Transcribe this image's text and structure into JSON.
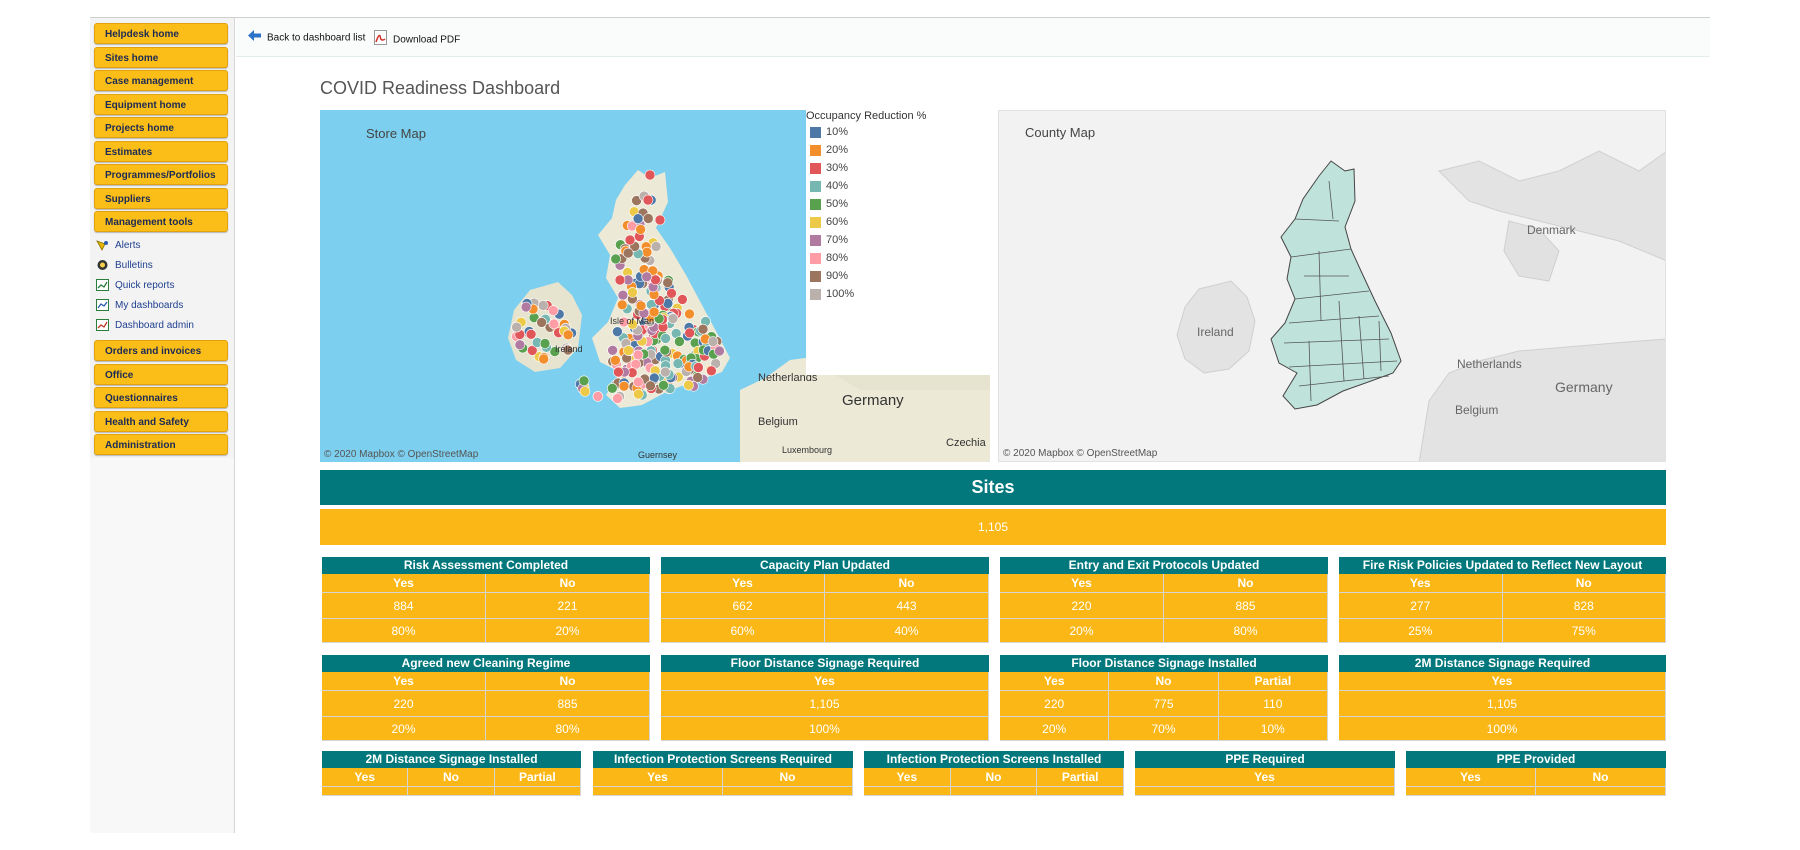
{
  "sidebar": {
    "items": [
      {
        "label": "Helpdesk home",
        "type": "button"
      },
      {
        "label": "Sites home",
        "type": "button"
      },
      {
        "label": "Case management",
        "type": "button"
      },
      {
        "label": "Equipment home",
        "type": "button"
      },
      {
        "label": "Projects home",
        "type": "button"
      },
      {
        "label": "Estimates",
        "type": "button"
      },
      {
        "label": "Programmes/Portfolios",
        "type": "button"
      },
      {
        "label": "Suppliers",
        "type": "button"
      },
      {
        "label": "Management tools",
        "type": "button"
      },
      {
        "label": "Alerts",
        "type": "link",
        "icon": "bell-icon"
      },
      {
        "label": "Bulletins",
        "type": "link",
        "icon": "bulletin-icon"
      },
      {
        "label": "Quick reports",
        "type": "link",
        "icon": "report-icon"
      },
      {
        "label": "My dashboards",
        "type": "link",
        "icon": "dashboard-icon"
      },
      {
        "label": "Dashboard admin",
        "type": "link",
        "icon": "dashboard-admin-icon"
      },
      {
        "label": "Orders and invoices",
        "type": "button"
      },
      {
        "label": "Office",
        "type": "button"
      },
      {
        "label": "Questionnaires",
        "type": "button"
      },
      {
        "label": "Health and Safety",
        "type": "button"
      },
      {
        "label": "Administration",
        "type": "button"
      }
    ]
  },
  "toolbar": {
    "back_label": "Back to dashboard list",
    "pdf_label": "Download PDF"
  },
  "dashboard": {
    "title": "COVID Readiness Dashboard"
  },
  "store_map": {
    "title": "Store Map",
    "attribution": "© 2020 Mapbox © OpenStreetMap",
    "labels": [
      "Netherlands",
      "Germany",
      "Belgium",
      "Luxembourg",
      "Czechia",
      "Guernsey",
      "Ireland",
      "Isle of Man"
    ]
  },
  "legend": {
    "title": "Occupancy Reduction %",
    "items": [
      {
        "label": "10%",
        "color": "#4e79a7"
      },
      {
        "label": "20%",
        "color": "#f28e2b"
      },
      {
        "label": "30%",
        "color": "#e15759"
      },
      {
        "label": "40%",
        "color": "#76b7b2"
      },
      {
        "label": "50%",
        "color": "#59a14f"
      },
      {
        "label": "60%",
        "color": "#edc948"
      },
      {
        "label": "70%",
        "color": "#b07aa1"
      },
      {
        "label": "80%",
        "color": "#ff9da7"
      },
      {
        "label": "90%",
        "color": "#9c755f"
      },
      {
        "label": "100%",
        "color": "#bab0ac"
      }
    ]
  },
  "county_map": {
    "title": "County Map",
    "attribution": "© 2020 Mapbox © OpenStreetMap",
    "labels": [
      "Denmark",
      "Ireland",
      "Netherlands",
      "Germany",
      "Belgium"
    ]
  },
  "sites": {
    "header": "Sites",
    "count": "1,105"
  },
  "metrics": [
    {
      "title": "Risk Assessment Completed",
      "columns": [
        "Yes",
        "No"
      ],
      "counts": [
        "884",
        "221"
      ],
      "percents": [
        "80%",
        "20%"
      ]
    },
    {
      "title": "Capacity Plan Updated",
      "columns": [
        "Yes",
        "No"
      ],
      "counts": [
        "662",
        "443"
      ],
      "percents": [
        "60%",
        "40%"
      ]
    },
    {
      "title": "Entry and Exit Protocols Updated",
      "columns": [
        "Yes",
        "No"
      ],
      "counts": [
        "220",
        "885"
      ],
      "percents": [
        "20%",
        "80%"
      ]
    },
    {
      "title": "Fire Risk Policies Updated to Reflect New Layout",
      "columns": [
        "Yes",
        "No"
      ],
      "counts": [
        "277",
        "828"
      ],
      "percents": [
        "25%",
        "75%"
      ]
    },
    {
      "title": "Agreed new Cleaning Regime",
      "columns": [
        "Yes",
        "No"
      ],
      "counts": [
        "220",
        "885"
      ],
      "percents": [
        "20%",
        "80%"
      ]
    },
    {
      "title": "Floor Distance Signage Required",
      "columns": [
        "Yes"
      ],
      "counts": [
        "1,105"
      ],
      "percents": [
        "100%"
      ]
    },
    {
      "title": "Floor Distance Signage Installed",
      "columns": [
        "Yes",
        "No",
        "Partial"
      ],
      "counts": [
        "220",
        "775",
        "110"
      ],
      "percents": [
        "20%",
        "70%",
        "10%"
      ]
    },
    {
      "title": "2M Distance Signage Required",
      "columns": [
        "Yes"
      ],
      "counts": [
        "1,105"
      ],
      "percents": [
        "100%"
      ]
    },
    {
      "title": "2M Distance Signage Installed",
      "columns": [
        "Yes",
        "No",
        "Partial"
      ]
    },
    {
      "title": "Infection Protection Screens Required",
      "columns": [
        "Yes",
        "No"
      ]
    },
    {
      "title": "Infection Protection Screens Installed",
      "columns": [
        "Yes",
        "No",
        "Partial"
      ]
    },
    {
      "title": "PPE Required",
      "columns": [
        "Yes"
      ]
    },
    {
      "title": "PPE Provided",
      "columns": [
        "Yes",
        "No"
      ]
    }
  ]
}
